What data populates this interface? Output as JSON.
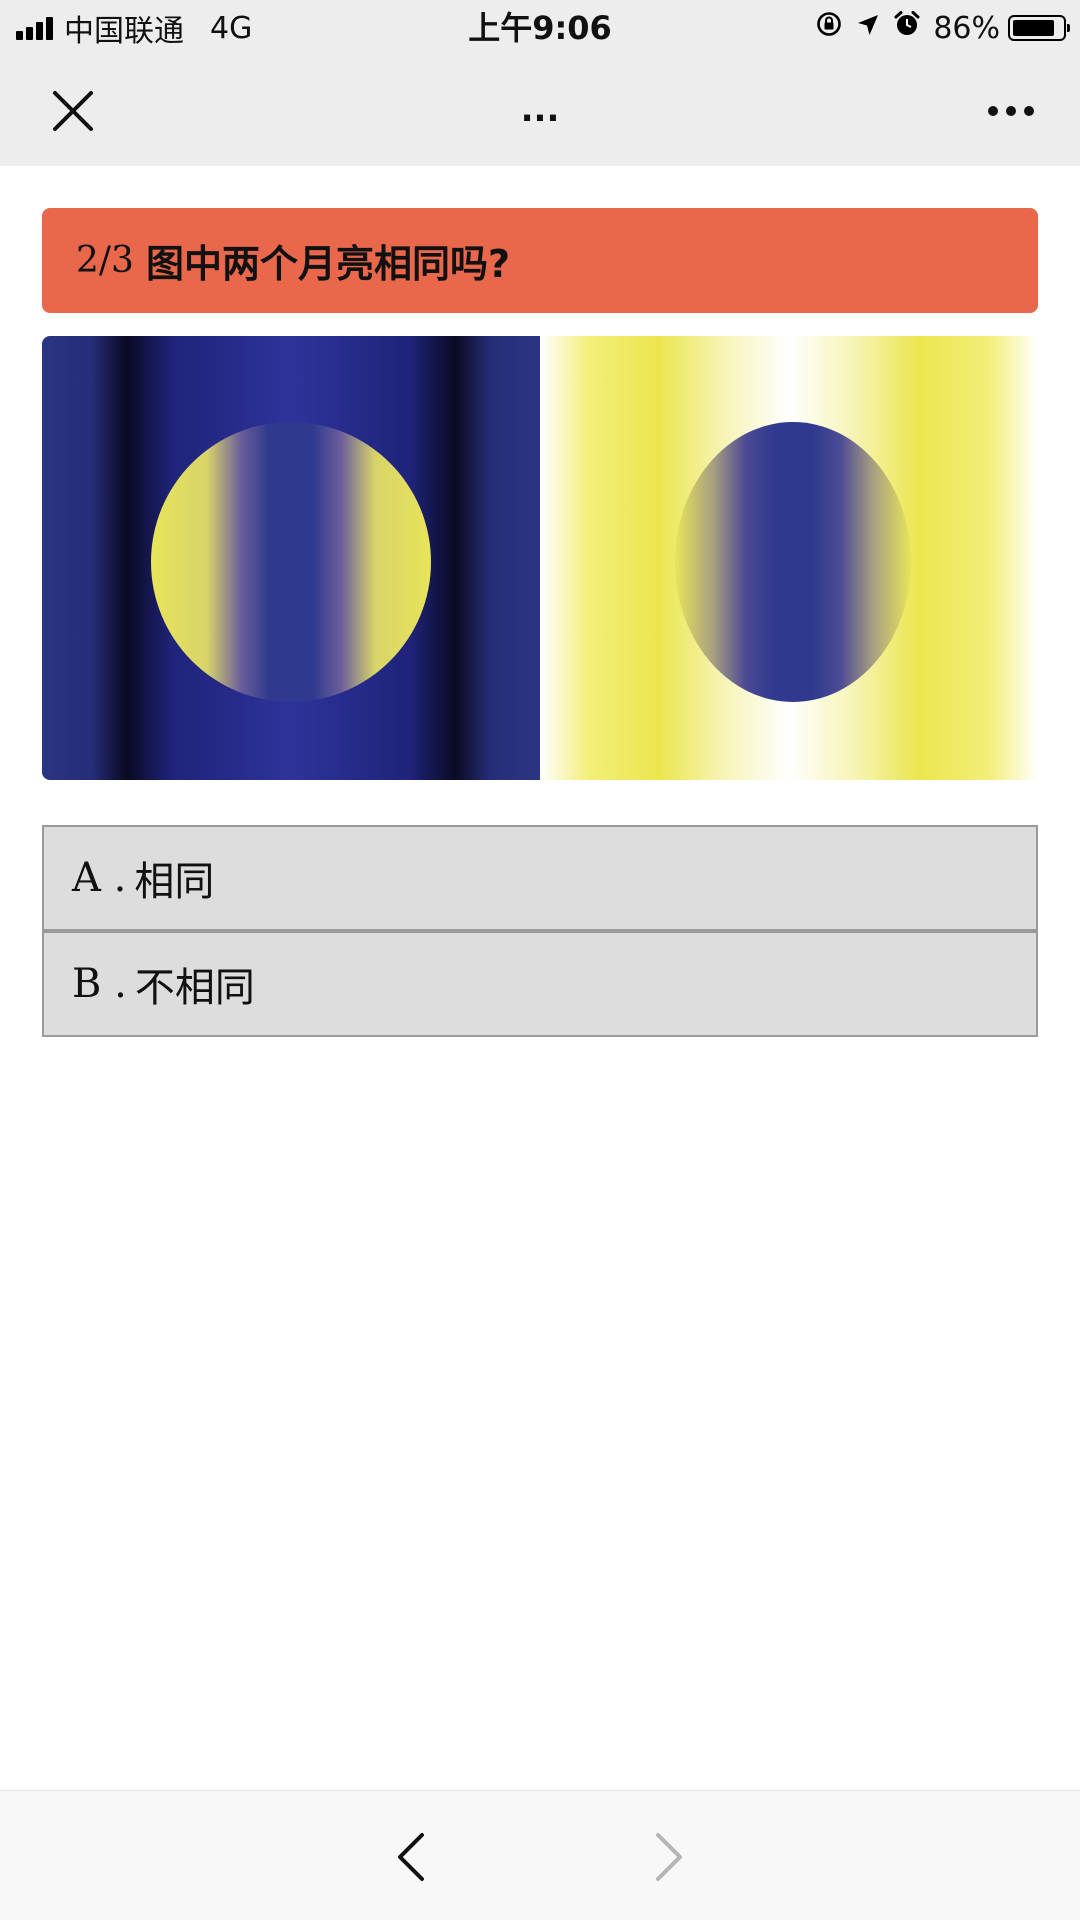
{
  "status_bar": {
    "carrier": "中国联通",
    "network": "4G",
    "time": "上午9:06",
    "battery_percent": "86%",
    "battery_level": 0.86
  },
  "nav": {
    "title": "...",
    "close_icon": "close-icon",
    "more_icon": "more-icon"
  },
  "question": {
    "progress": "2/3",
    "text": "图中两个月亮相同吗?"
  },
  "options": [
    {
      "letter": "A .",
      "label": "相同"
    },
    {
      "letter": "B .",
      "label": "不相同"
    }
  ],
  "toolbar": {
    "back_icon": "chevron-left-icon",
    "forward_icon": "chevron-right-icon"
  },
  "colors": {
    "header_bg": "#e9674b",
    "option_bg": "#dddddd",
    "navy": "#2a3280",
    "yellow": "#e9e44f"
  }
}
